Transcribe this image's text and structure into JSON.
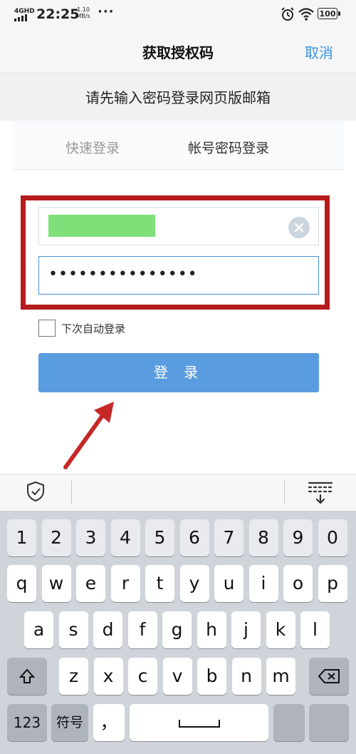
{
  "status_bar": {
    "network": "4GHD",
    "time": "22:25",
    "speed_value": "1.10",
    "speed_unit": "MB/s",
    "more": "···",
    "battery": "100"
  },
  "nav": {
    "title": "获取授权码",
    "cancel": "取消"
  },
  "page": {
    "subtitle": "请先输入密码登录网页版邮箱",
    "tabs": [
      "快速登录",
      "帐号密码登录"
    ],
    "password_masked": "•••••••••••••••",
    "auto_login_label": "下次自动登录",
    "login_button": "登 录"
  },
  "keyboard": {
    "row_numbers": [
      "1",
      "2",
      "3",
      "4",
      "5",
      "6",
      "7",
      "8",
      "9",
      "0"
    ],
    "row1": [
      "q",
      "w",
      "e",
      "r",
      "t",
      "y",
      "u",
      "i",
      "o",
      "p"
    ],
    "row2": [
      "a",
      "s",
      "d",
      "f",
      "g",
      "h",
      "j",
      "k",
      "l"
    ],
    "row3": [
      "z",
      "x",
      "c",
      "v",
      "b",
      "n",
      "m"
    ],
    "bottom": {
      "num": "123",
      "symbols": "符号",
      "comma": "，"
    }
  }
}
